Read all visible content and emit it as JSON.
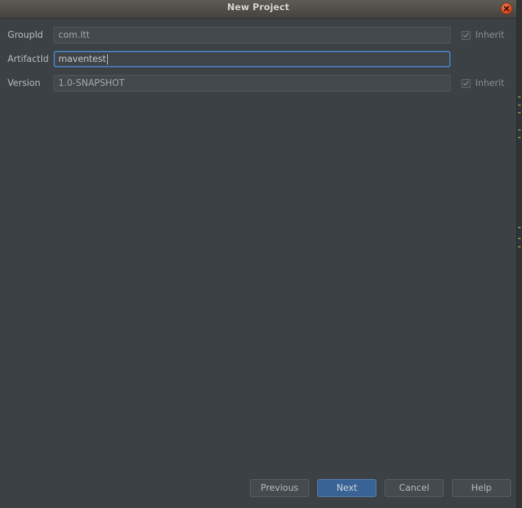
{
  "window": {
    "title": "New Project",
    "close_icon": "close-icon",
    "bg_color": "#3c4145",
    "titlebar_color": "#53514b",
    "accent_color": "#3a6395",
    "close_color": "#e2512a"
  },
  "form": {
    "fields": [
      {
        "label": "GroupId",
        "value": "com.ltt",
        "focused": false,
        "has_inherit": true,
        "inherit_label": "Inherit",
        "inherit_checked": true,
        "inherit_enabled": false
      },
      {
        "label": "ArtifactId",
        "value": "maventest",
        "focused": true,
        "has_inherit": false,
        "inherit_label": "",
        "inherit_checked": false,
        "inherit_enabled": false
      },
      {
        "label": "Version",
        "value": "1.0-SNAPSHOT",
        "focused": false,
        "has_inherit": true,
        "inherit_label": "Inherit",
        "inherit_checked": true,
        "inherit_enabled": false
      }
    ]
  },
  "footer": {
    "buttons": [
      {
        "label": "Previous",
        "primary": false
      },
      {
        "label": "Next",
        "primary": true
      },
      {
        "label": "Cancel",
        "primary": false
      },
      {
        "label": "Help",
        "primary": false
      }
    ]
  },
  "background_strip": {
    "color": "#313335",
    "marker_color": "#6a8f4e",
    "markers": [
      140,
      152,
      163,
      188,
      199,
      330,
      346,
      358
    ]
  }
}
